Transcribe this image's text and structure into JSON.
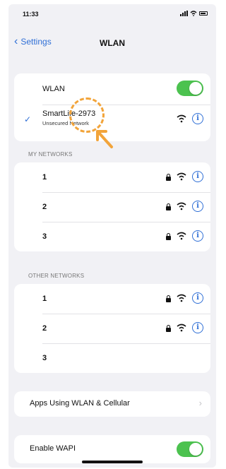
{
  "status": {
    "time": "11:33"
  },
  "nav": {
    "back_label": "Settings",
    "title": "WLAN"
  },
  "wlan": {
    "label": "WLAN",
    "enabled": true
  },
  "connected": {
    "name": "SmartLife-2973",
    "subtitle": "Unsecured Network"
  },
  "my_networks": {
    "header": "MY NETWORKS",
    "items": [
      {
        "label": "1"
      },
      {
        "label": "2"
      },
      {
        "label": "3"
      }
    ]
  },
  "other_networks": {
    "header": "OTHER NETWORKS",
    "items": [
      {
        "label": "1"
      },
      {
        "label": "2"
      },
      {
        "label": "3"
      }
    ]
  },
  "apps_row": {
    "label": "Apps Using WLAN & Cellular"
  },
  "wapi": {
    "label": "Enable WAPI",
    "enabled": true
  },
  "colors": {
    "accent": "#2f6fd6",
    "toggle_on": "#4cc24f",
    "annotation": "#f2a43a"
  }
}
